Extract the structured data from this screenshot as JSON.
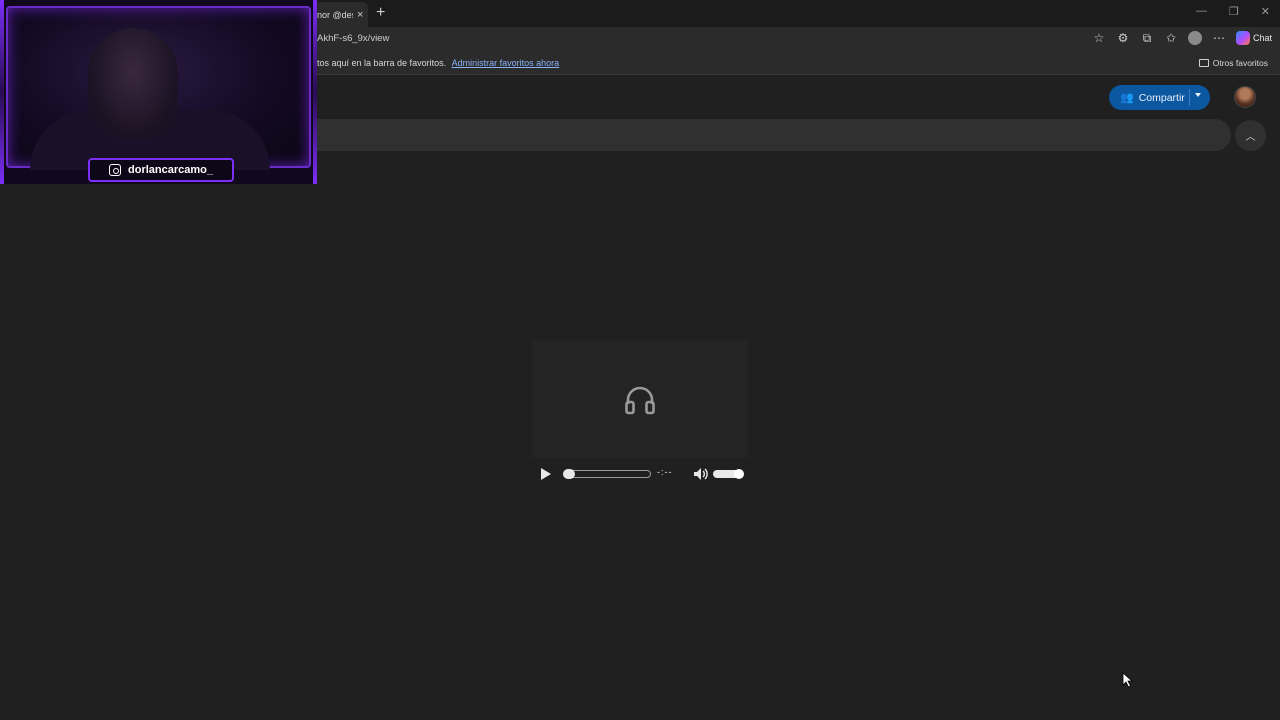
{
  "browser": {
    "tab_title": "nor @des",
    "tab_close": "×",
    "new_tab": "+",
    "url": "AkhF-s6_9x/view",
    "chat_label": "Chat",
    "favorites_hint": "tos aquí en la barra de favoritos.",
    "favorites_link": "Administrar favoritos ahora",
    "other_favorites": "Otros favoritos"
  },
  "drive": {
    "share_label": "Compartir"
  },
  "player": {
    "time": "-:--",
    "progress": 0,
    "volume": 1.0
  },
  "overlay": {
    "username": "dorlancarcamo_"
  },
  "colors": {
    "accent": "#0b57a0",
    "overlay_purple": "#7b2ff7"
  }
}
